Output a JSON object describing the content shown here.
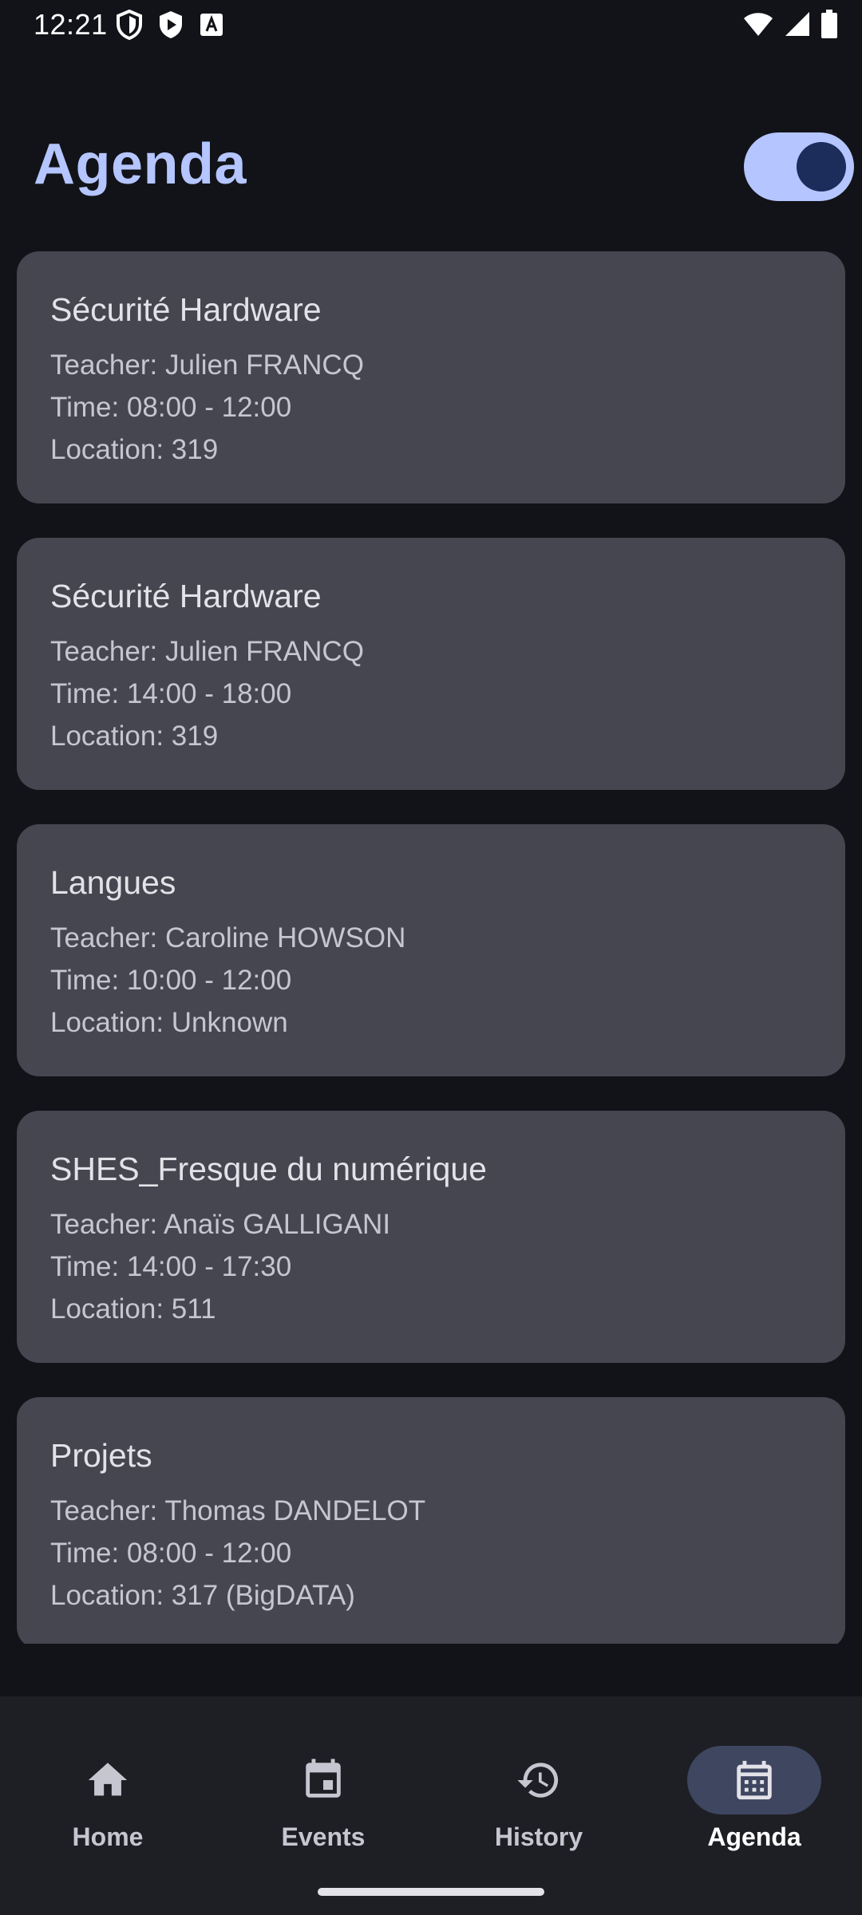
{
  "status_bar": {
    "time": "12:21",
    "left_icons": [
      "shield-icon",
      "play-protect-icon",
      "font-a-icon"
    ],
    "right_icons": [
      "wifi-icon",
      "signal-icon",
      "battery-icon"
    ]
  },
  "header": {
    "title": "Agenda",
    "toggle_on": true
  },
  "cards": [
    {
      "title": "Sécurité Hardware",
      "teacher": "Teacher: Julien FRANCQ",
      "time": "Time: 08:00 - 12:00",
      "location": "Location: 319"
    },
    {
      "title": "Sécurité Hardware",
      "teacher": "Teacher: Julien FRANCQ",
      "time": "Time: 14:00 - 18:00",
      "location": "Location: 319"
    },
    {
      "title": "Langues",
      "teacher": "Teacher: Caroline HOWSON",
      "time": "Time: 10:00 - 12:00",
      "location": "Location: Unknown"
    },
    {
      "title": "SHES_Fresque du numérique",
      "teacher": "Teacher: Anaïs GALLIGANI",
      "time": "Time: 14:00 - 17:30",
      "location": "Location: 511"
    },
    {
      "title": "Projets",
      "teacher": "Teacher: Thomas DANDELOT",
      "time": "Time: 08:00 - 12:00",
      "location": "Location: 317 (BigDATA)"
    }
  ],
  "bottom_nav": {
    "items": [
      {
        "label": "Home",
        "icon": "home-icon",
        "active": false
      },
      {
        "label": "Events",
        "icon": "calendar-event-icon",
        "active": false
      },
      {
        "label": "History",
        "icon": "history-icon",
        "active": false
      },
      {
        "label": "Agenda",
        "icon": "calendar-month-icon",
        "active": true
      }
    ]
  },
  "colors": {
    "background": "#121318",
    "card": "#45464f",
    "accent": "#b4c5ff",
    "nav_background": "#1e1f25",
    "nav_active_indicator": "#3e4660"
  }
}
